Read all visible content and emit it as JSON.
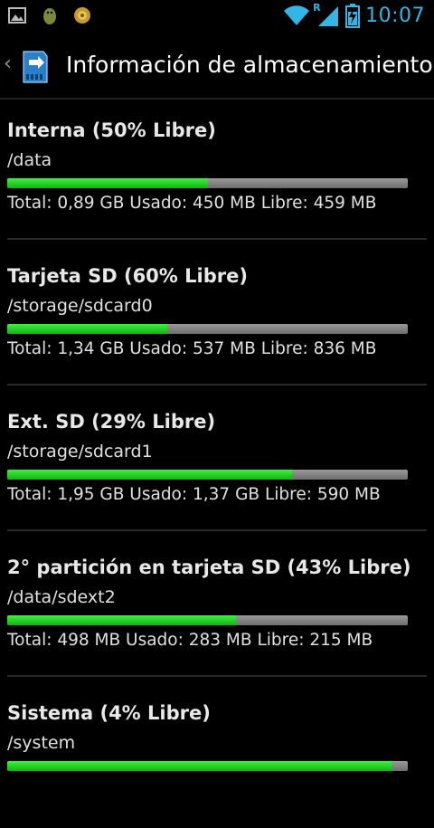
{
  "status_bar": {
    "time": "10:07",
    "network_roaming": "R",
    "icons": [
      "image-icon",
      "android-icon",
      "settings-app-icon",
      "wifi-icon",
      "signal-icon",
      "battery-charging-icon"
    ]
  },
  "action_bar": {
    "title": "Información de almacenamiento",
    "icon": "sd-card-transfer-icon"
  },
  "storage": [
    {
      "title": "Interna (50% Libre)",
      "path": "/data",
      "used_fraction": 0.5,
      "details": "Total: 0,89 GB Usado: 450 MB Libre: 459 MB"
    },
    {
      "title": "Tarjeta SD (60% Libre)",
      "path": "/storage/sdcard0",
      "used_fraction": 0.4,
      "details": "Total: 1,34 GB Usado: 537 MB Libre: 836 MB"
    },
    {
      "title": "Ext. SD (29% Libre)",
      "path": "/storage/sdcard1",
      "used_fraction": 0.71,
      "details": "Total: 1,95 GB Usado: 1,37 GB Libre: 590 MB"
    },
    {
      "title": "2° partición en tarjeta SD (43% Libre)",
      "path": "/data/sdext2",
      "used_fraction": 0.57,
      "details": "Total: 498 MB Usado: 283 MB Libre: 215 MB"
    },
    {
      "title": "Sistema (4% Libre)",
      "path": "/system",
      "used_fraction": 0.96,
      "details": ""
    }
  ],
  "colors": {
    "accent_clock": "#33b5e5",
    "bar_used": "#22cc22",
    "bar_free": "#808080"
  }
}
